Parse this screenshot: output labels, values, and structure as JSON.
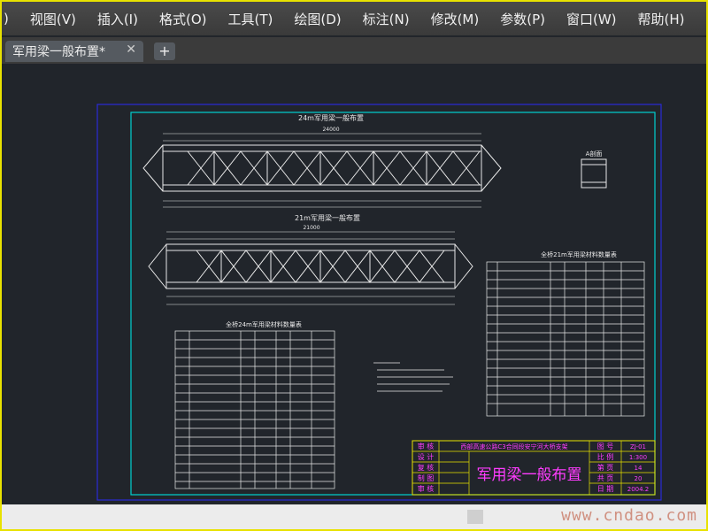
{
  "menu": {
    "items": [
      ")",
      "视图(V)",
      "插入(I)",
      "格式(O)",
      "工具(T)",
      "绘图(D)",
      "标注(N)",
      "修改(M)",
      "参数(P)",
      "窗口(W)",
      "帮助(H)"
    ]
  },
  "tabs": {
    "active_label": "军用梁一般布置*",
    "close_glyph": "✕",
    "new_tab_glyph": "+"
  },
  "drawing": {
    "title_24m": "24m军用梁一般布置",
    "title_21m": "21m军用梁一般布置",
    "dim_24": "24000",
    "dim_21": "21000",
    "section_label": "A剖面",
    "table_24_title": "全桥24m军用梁材料数量表",
    "table_21_title": "全桥21m军用梁材料数量表"
  },
  "title_block": {
    "labels": [
      "审 核",
      "设 计",
      "复 核",
      "制 图",
      "审 核"
    ],
    "project": "西部高速公路C3合同段安宁河大桥支架",
    "drawing_title": "军用梁一般布置",
    "right_labels": [
      "图 号",
      "比 例",
      "第 页",
      "共 页",
      "日 期"
    ],
    "right_values": [
      "ZJ-01",
      "1:300",
      "14",
      "20",
      "2004.2"
    ]
  },
  "status": {
    "watermark": "www.cndao.com"
  },
  "colors": {
    "frame": "#e8e200",
    "border_blue": "#2a2ad8",
    "border_cyan": "#00d0d0",
    "drawing_white": "#e8e8e8",
    "title_yellow": "#e8e200",
    "title_magenta": "#ff3cff",
    "background": "#21252b"
  }
}
